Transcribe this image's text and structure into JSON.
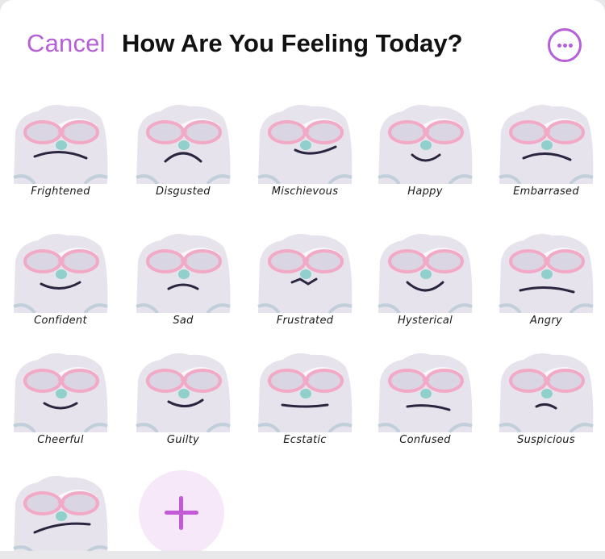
{
  "header": {
    "cancel_label": "Cancel",
    "title": "How Are You Feeling Today?",
    "more_icon": "ellipsis-circle-icon"
  },
  "colors": {
    "accent": "#b65fd6",
    "fur": "#e6e3ec",
    "glasses": "#f2a9c6",
    "nose": "#8fd0cc",
    "add_bg": "#f6e8f8"
  },
  "emotions": [
    {
      "label": "Frightened"
    },
    {
      "label": "Disgusted"
    },
    {
      "label": "Mischievous"
    },
    {
      "label": "Happy"
    },
    {
      "label": "Embarrased"
    },
    {
      "label": "Confident"
    },
    {
      "label": "Sad"
    },
    {
      "label": "Frustrated"
    },
    {
      "label": "Hysterical"
    },
    {
      "label": "Angry"
    },
    {
      "label": "Cheerful"
    },
    {
      "label": "Guilty"
    },
    {
      "label": "Ecstatic"
    },
    {
      "label": "Confused"
    },
    {
      "label": "Suspicious"
    },
    {
      "label": ""
    }
  ],
  "add_button": {
    "icon": "plus-icon"
  }
}
